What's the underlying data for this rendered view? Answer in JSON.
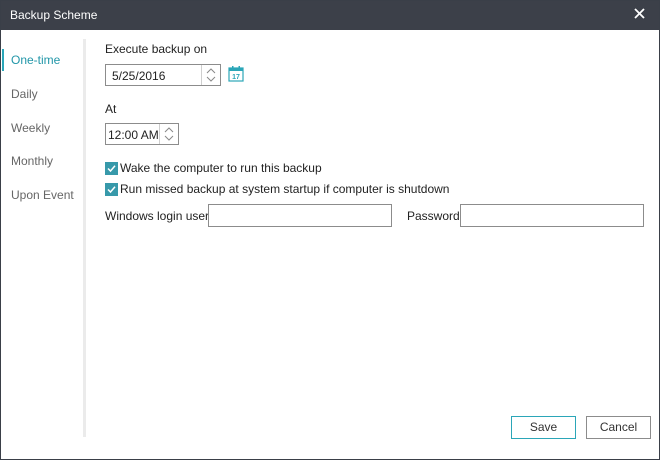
{
  "window": {
    "title": "Backup Scheme"
  },
  "sidebar": {
    "items": [
      {
        "label": "One-time",
        "active": true
      },
      {
        "label": "Daily",
        "active": false
      },
      {
        "label": "Weekly",
        "active": false
      },
      {
        "label": "Monthly",
        "active": false
      },
      {
        "label": "Upon Event",
        "active": false
      }
    ]
  },
  "form": {
    "execute_label": "Execute backup on",
    "date_value": "5/25/2016",
    "calendar_icon_text": "17",
    "at_label": "At",
    "time_value": "12:00 AM",
    "wake_checkbox": {
      "label": "Wake the computer to run this backup",
      "checked": true
    },
    "missed_checkbox": {
      "label": "Run missed backup at system startup if computer is shutdown",
      "checked": true
    },
    "windows_user_label": "Windows login user:",
    "windows_user_value": "",
    "password_label": "Password:",
    "password_value": ""
  },
  "buttons": {
    "save": "Save",
    "cancel": "Cancel"
  },
  "colors": {
    "accent": "#2ba6b8",
    "titlebar": "#3c4049",
    "checkbox": "#3799aa"
  }
}
